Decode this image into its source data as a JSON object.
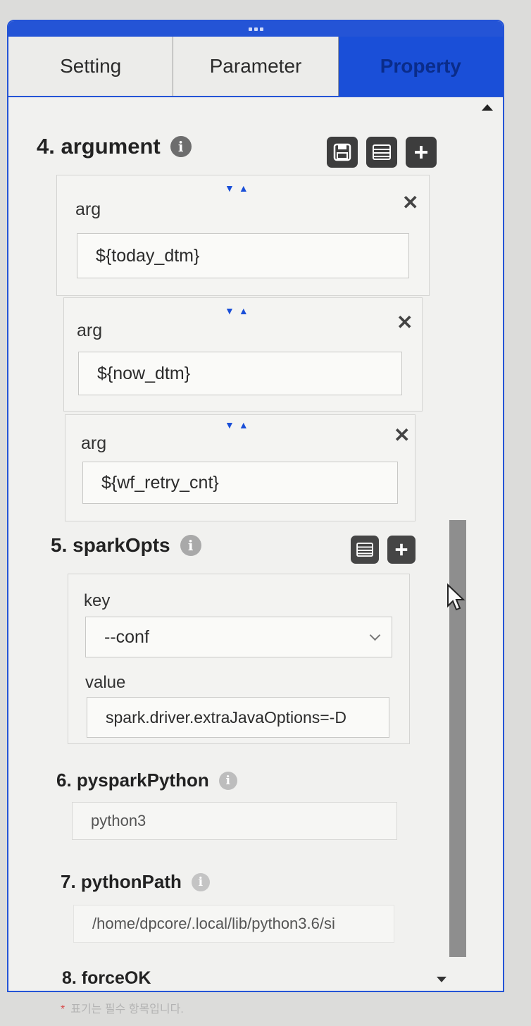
{
  "tabs": [
    {
      "label": "Setting"
    },
    {
      "label": "Parameter"
    },
    {
      "label": "Property"
    }
  ],
  "sections": {
    "argument": {
      "title": "4. argument",
      "items": [
        {
          "label": "arg",
          "value": "${today_dtm}"
        },
        {
          "label": "arg",
          "value": "${now_dtm}"
        },
        {
          "label": "arg",
          "value": "${wf_retry_cnt}"
        }
      ]
    },
    "sparkOpts": {
      "title": "5. sparkOpts",
      "key_label": "key",
      "key_value": "--conf",
      "value_label": "value",
      "value_value": "spark.driver.extraJavaOptions=-D"
    },
    "pysparkPython": {
      "title": "6. pysparkPython",
      "value": "python3"
    },
    "pythonPath": {
      "title": "7. pythonPath",
      "value": "/home/dpcore/.local/lib/python3.6/si"
    },
    "forceOK": {
      "title": "8. forceOK"
    }
  },
  "footer": {
    "star": "*",
    "note": "표기는 필수 항목입니다."
  },
  "icons": {
    "info": "info-icon",
    "save": "save-icon",
    "list": "list-icon",
    "add": "plus-icon",
    "close": "close-icon",
    "sort": "sort-arrows-icon"
  },
  "colors": {
    "accent": "#2454d6",
    "active_tab": "#1a4fd8",
    "icon_button": "#3d3d3d"
  }
}
